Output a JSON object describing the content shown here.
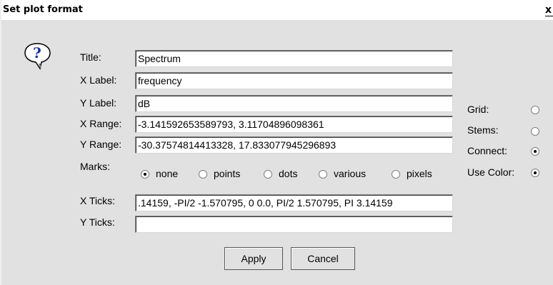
{
  "window": {
    "title": "Set plot format",
    "close_glyph": "x"
  },
  "icon": {
    "name": "question-icon",
    "glyph": "?"
  },
  "fields": {
    "title": {
      "label": "Title:",
      "value": "Spectrum"
    },
    "xlabel": {
      "label": "X Label:",
      "value": "frequency"
    },
    "ylabel": {
      "label": "Y Label:",
      "value": "dB"
    },
    "xrange": {
      "label": "X Range:",
      "value": "-3.141592653589793, 3.11704896098361"
    },
    "yrange": {
      "label": "Y Range:",
      "value": "-30.37574814413328, 17.833077945296893"
    },
    "xticks": {
      "label": "X Ticks:",
      "value": ".14159, -PI/2 -1.570795, 0 0.0, PI/2 1.570795, PI 3.14159"
    },
    "yticks": {
      "label": "Y Ticks:",
      "value": ""
    }
  },
  "marks": {
    "label": "Marks:",
    "options": [
      "none",
      "points",
      "dots",
      "various",
      "pixels"
    ],
    "selected": "none"
  },
  "options": {
    "grid": {
      "label": "Grid:",
      "checked": false
    },
    "stems": {
      "label": "Stems:",
      "checked": false
    },
    "connect": {
      "label": "Connect:",
      "checked": true
    },
    "use_color": {
      "label": "Use Color:",
      "checked": true
    }
  },
  "buttons": {
    "apply": "Apply",
    "cancel": "Cancel"
  }
}
